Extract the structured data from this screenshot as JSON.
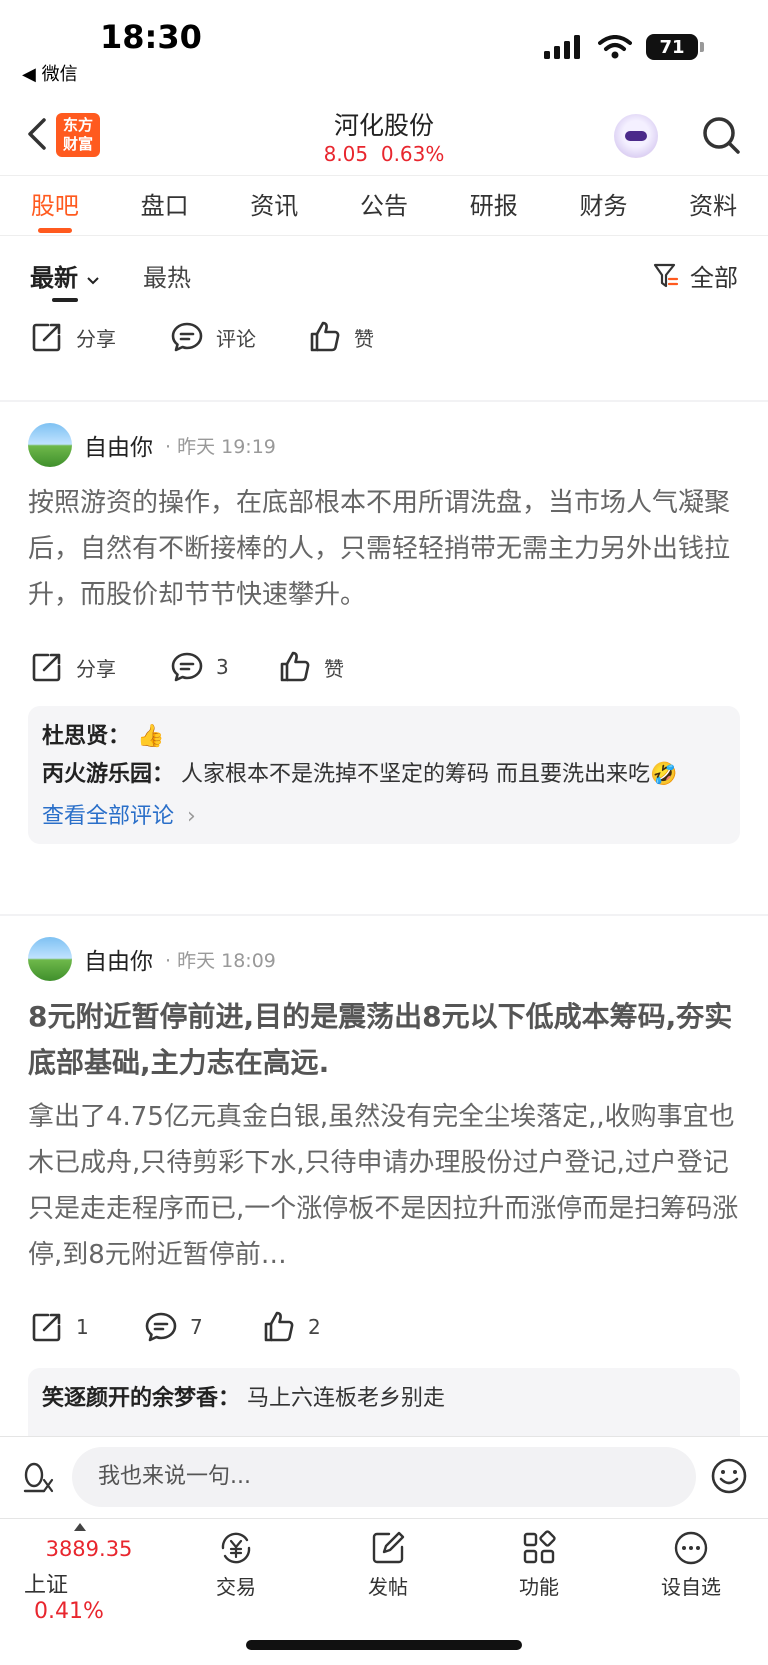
{
  "status": {
    "time": "18:30",
    "back_app": "◀ 微信",
    "battery": "71"
  },
  "header": {
    "stock_name": "河化股份",
    "price": "8.05",
    "change_pct": "0.63%",
    "logo_line1": "东方",
    "logo_line2": "财富"
  },
  "tabs": [
    {
      "label": "股吧"
    },
    {
      "label": "盘口"
    },
    {
      "label": "资讯"
    },
    {
      "label": "公告"
    },
    {
      "label": "研报"
    },
    {
      "label": "财务"
    },
    {
      "label": "资料"
    }
  ],
  "filter": {
    "latest": "最新",
    "hot": "最热",
    "all": "全部"
  },
  "top_actions": {
    "share": "分享",
    "comment": "评论",
    "like": "赞"
  },
  "posts": [
    {
      "author": "自由你",
      "time": "· 昨天 19:19",
      "body": "按照游资的操作，在底部根本不用所谓洗盘，当市场人气凝聚后，自然有不断接棒的人，只需轻轻捎带无需主力另外出钱拉升，而股价却节节快速攀升。",
      "actions": {
        "share": "分享",
        "comment": "3",
        "like": "赞"
      },
      "comments": [
        {
          "author": "杜思贤：",
          "text": "👍"
        },
        {
          "author": "丙火游乐园：",
          "text": "人家根本不是洗掉不坚定的筹码 而且要洗出来吃🤣"
        }
      ],
      "view_all": "查看全部评论"
    },
    {
      "author": "自由你",
      "time": "· 昨天 18:09",
      "title": "8元附近暂停前进,目的是震荡出8元以下低成本筹码,夯实底部基础,主力志在高远.",
      "body": "拿出了4.75亿元真金白银,虽然没有完全尘埃落定,,收购事宜也木已成舟,只待剪彩下水,只待申请办理股份过户登记,过户登记只是走走程序而已,一个涨停板不是因拉升而涨停而是扫筹码涨停,到8元附近暂停前…",
      "actions": {
        "share": "1",
        "comment": "7",
        "like": "2"
      },
      "comments": [
        {
          "author": "笑逐颜开的余梦香：",
          "text": "马上六连板老乡别走"
        }
      ]
    }
  ],
  "input": {
    "placeholder": "我也来说一句..."
  },
  "bottom_nav": {
    "index_value": "3889.35",
    "index_name": "上证",
    "index_pct": "0.41%",
    "items": [
      {
        "label": "交易"
      },
      {
        "label": "发帖"
      },
      {
        "label": "功能"
      },
      {
        "label": "设自选"
      }
    ]
  },
  "colors": {
    "accent": "#ff5a1f",
    "up_red": "#e8262e",
    "link_blue": "#2a6fc9"
  }
}
